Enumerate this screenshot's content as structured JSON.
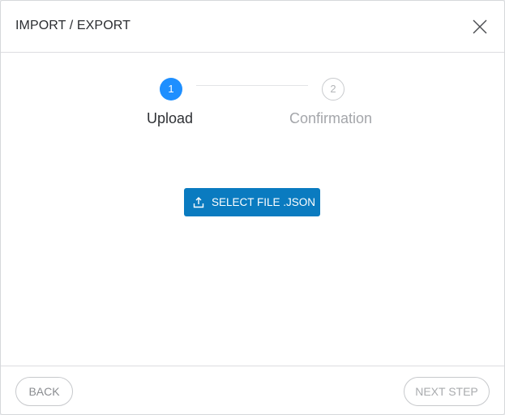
{
  "header": {
    "title": "IMPORT / EXPORT"
  },
  "stepper": {
    "steps": [
      {
        "number": "1",
        "label": "Upload",
        "state": "active"
      },
      {
        "number": "2",
        "label": "Confirmation",
        "state": "inactive"
      }
    ]
  },
  "main": {
    "select_file_label": "SELECT FILE .JSON"
  },
  "footer": {
    "back_label": "BACK",
    "next_label": "NEXT STEP"
  },
  "colors": {
    "accent": "#1e8fff",
    "primary_button": "#0a7bc0"
  },
  "icons": {
    "close": "close-icon",
    "upload": "upload-icon"
  }
}
